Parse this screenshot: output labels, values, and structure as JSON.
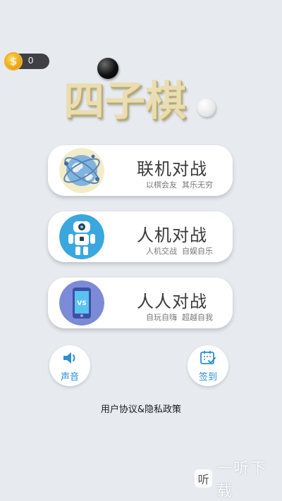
{
  "coins": {
    "count": "0",
    "icon": "dollar-coin-icon"
  },
  "title": {
    "text": "四子棋"
  },
  "menu": [
    {
      "id": "online",
      "title": "联机对战",
      "subtitle": "以棋会友  其乐无穷",
      "icon": "globe-network-icon"
    },
    {
      "id": "ai",
      "title": "人机对战",
      "subtitle": "人机交战  自娱自乐",
      "icon": "robot-icon"
    },
    {
      "id": "local",
      "title": "人人对战",
      "subtitle": "自玩自嗨  超越自我",
      "icon": "phone-vs-icon",
      "icon_text": "VS"
    }
  ],
  "sound": {
    "label": "声音",
    "icon": "speaker-icon"
  },
  "checkin": {
    "label": "签到",
    "icon": "calendar-check-icon"
  },
  "policy": {
    "label": "用户协议&隐私政策"
  },
  "watermark": {
    "logo_text": "听",
    "text": "一听下载"
  },
  "colors": {
    "background": "#e7ebf0",
    "accent_blue": "#2f8fd4",
    "card_bg": "#ffffff"
  }
}
